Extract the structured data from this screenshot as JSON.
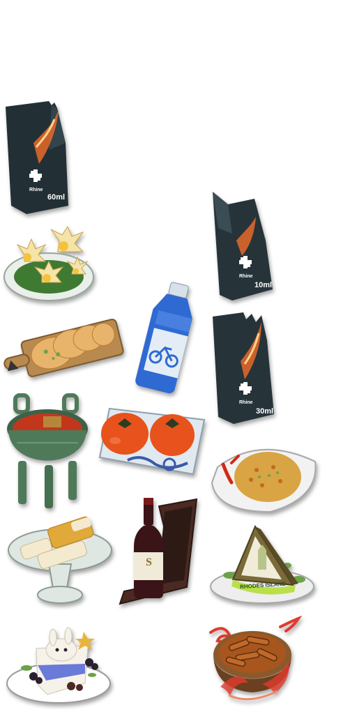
{
  "sheet": {
    "background": "#ffffff"
  },
  "items": [
    {
      "id": "medic-carton-60ml",
      "icon": "medic-carton-icon",
      "brand": "Rhine",
      "volume": "60ml",
      "colors": {
        "body": "#223036",
        "accent": "#e86a2c",
        "label": "#ffffff"
      }
    },
    {
      "id": "medic-carton-10ml",
      "icon": "medic-carton-icon",
      "brand": "Rhine",
      "volume": "10ml",
      "colors": {
        "body": "#26343a",
        "accent": "#e86a2c",
        "label": "#ffffff"
      }
    },
    {
      "id": "lotus-dessert-plate",
      "icon": "lotus-pastry-icon",
      "colors": {
        "petal": "#f5e3a8",
        "leaf": "#3f7a33",
        "plate": "#e9efe9"
      }
    },
    {
      "id": "water-bottle",
      "icon": "water-bottle-icon",
      "colors": {
        "glass": "#2f6ad3",
        "cap": "#d8e0ea",
        "label": "#e4edf6"
      }
    },
    {
      "id": "flatbread-board",
      "icon": "flatbread-board-icon",
      "colors": {
        "board": "#b98a4f",
        "bread": "#e8b36a"
      }
    },
    {
      "id": "medic-carton-30ml",
      "icon": "medic-carton-icon",
      "brand": "Rhine",
      "volume": "30ml",
      "colors": {
        "body": "#26343a",
        "accent": "#e86a2c",
        "label": "#ffffff"
      }
    },
    {
      "id": "hotpot-cauldron",
      "icon": "bronze-cauldron-icon",
      "colors": {
        "bronze": "#4f7a5a",
        "soup": "#c2371c"
      }
    },
    {
      "id": "persimmon-plate",
      "icon": "persimmon-plate-icon",
      "colors": {
        "fruit": "#e8521c",
        "plate": "#dfe9ef",
        "pattern": "#3a5aa8"
      }
    },
    {
      "id": "fried-rice-plate",
      "icon": "fried-rice-icon",
      "colors": {
        "rice": "#d9a444",
        "chili": "#d12a14",
        "plate": "#f2f2f2"
      }
    },
    {
      "id": "rice-cake-stand",
      "icon": "rice-cake-stand-icon",
      "colors": {
        "cake": "#f4ead0",
        "syrup": "#e0a93a",
        "stand": "#dfe7e2"
      }
    },
    {
      "id": "wine-bottle-box",
      "icon": "wine-bottle-icon",
      "label_text": "S",
      "colors": {
        "bottle": "#3a1416",
        "box": "#4a2a22",
        "label": "#f0ead9"
      }
    },
    {
      "id": "pyramid-cake",
      "icon": "pyramid-cake-icon",
      "label_text": "RHODES ISLAND",
      "colors": {
        "cake": "#7a6a3a",
        "icing": "#b9e04a",
        "plate": "#eeeeee"
      }
    },
    {
      "id": "bunny-cake-slice",
      "icon": "bunny-cake-icon",
      "colors": {
        "cake": "#f6f2ea",
        "jelly": "#6a7ad8",
        "berry": "#2a2030"
      }
    },
    {
      "id": "flaming-snack-bowl",
      "icon": "flaming-bowl-icon",
      "colors": {
        "bowl": "#8a5a2c",
        "snack": "#a8561e",
        "flame": "#e23a2c"
      }
    }
  ]
}
